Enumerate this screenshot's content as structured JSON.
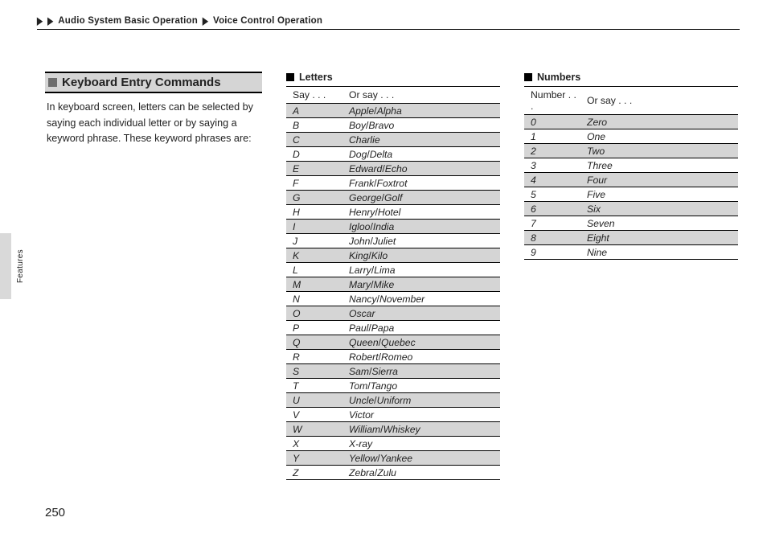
{
  "breadcrumb": {
    "seg1": "Audio System Basic Operation",
    "seg2": "Voice Control Operation"
  },
  "page_number": "250",
  "side_label": "Features",
  "section_heading": "Keyboard Entry Commands",
  "intro_text": "In keyboard screen, letters can be selected by saying each individual letter or by saying a keyword phrase. These keyword phrases are:",
  "letters": {
    "title": "Letters",
    "head1": "Say . . .",
    "head2": "Or say . . .",
    "rows": [
      {
        "k": "A",
        "v": [
          "Apple",
          "Alpha"
        ]
      },
      {
        "k": "B",
        "v": [
          "Boy",
          "Bravo"
        ]
      },
      {
        "k": "C",
        "v": [
          "Charlie"
        ]
      },
      {
        "k": "D",
        "v": [
          "Dog",
          "Delta"
        ]
      },
      {
        "k": "E",
        "v": [
          "Edward",
          "Echo"
        ]
      },
      {
        "k": "F",
        "v": [
          "Frank",
          "Foxtrot"
        ]
      },
      {
        "k": "G",
        "v": [
          "George",
          "Golf"
        ]
      },
      {
        "k": "H",
        "v": [
          "Henry",
          "Hotel"
        ]
      },
      {
        "k": "I",
        "v": [
          "Igloo",
          "India"
        ]
      },
      {
        "k": "J",
        "v": [
          "John",
          "Juliet"
        ]
      },
      {
        "k": "K",
        "v": [
          "King",
          "Kilo"
        ]
      },
      {
        "k": "L",
        "v": [
          "Larry",
          "Lima"
        ]
      },
      {
        "k": "M",
        "v": [
          "Mary",
          "Mike"
        ]
      },
      {
        "k": "N",
        "v": [
          "Nancy",
          "November"
        ]
      },
      {
        "k": "O",
        "v": [
          "Oscar"
        ]
      },
      {
        "k": "P",
        "v": [
          "Paul",
          "Papa"
        ]
      },
      {
        "k": "Q",
        "v": [
          "Queen",
          "Quebec"
        ]
      },
      {
        "k": "R",
        "v": [
          "Robert",
          "Romeo"
        ]
      },
      {
        "k": "S",
        "v": [
          "Sam",
          "Sierra"
        ]
      },
      {
        "k": "T",
        "v": [
          "Tom",
          "Tango"
        ]
      },
      {
        "k": "U",
        "v": [
          "Uncle",
          "Uniform"
        ]
      },
      {
        "k": "V",
        "v": [
          "Victor"
        ]
      },
      {
        "k": "W",
        "v": [
          "William",
          "Whiskey"
        ]
      },
      {
        "k": "X",
        "v": [
          "X-ray"
        ]
      },
      {
        "k": "Y",
        "v": [
          "Yellow",
          "Yankee"
        ]
      },
      {
        "k": "Z",
        "v": [
          "Zebra",
          "Zulu"
        ]
      }
    ]
  },
  "numbers": {
    "title": "Numbers",
    "head1": "Number . . .",
    "head2": "Or say . . .",
    "rows": [
      {
        "k": "0",
        "v": [
          "Zero"
        ]
      },
      {
        "k": "1",
        "v": [
          "One"
        ]
      },
      {
        "k": "2",
        "v": [
          "Two"
        ]
      },
      {
        "k": "3",
        "v": [
          "Three"
        ]
      },
      {
        "k": "4",
        "v": [
          "Four"
        ]
      },
      {
        "k": "5",
        "v": [
          "Five"
        ]
      },
      {
        "k": "6",
        "v": [
          "Six"
        ]
      },
      {
        "k": "7",
        "v": [
          "Seven"
        ]
      },
      {
        "k": "8",
        "v": [
          "Eight"
        ]
      },
      {
        "k": "9",
        "v": [
          "Nine"
        ]
      }
    ]
  }
}
